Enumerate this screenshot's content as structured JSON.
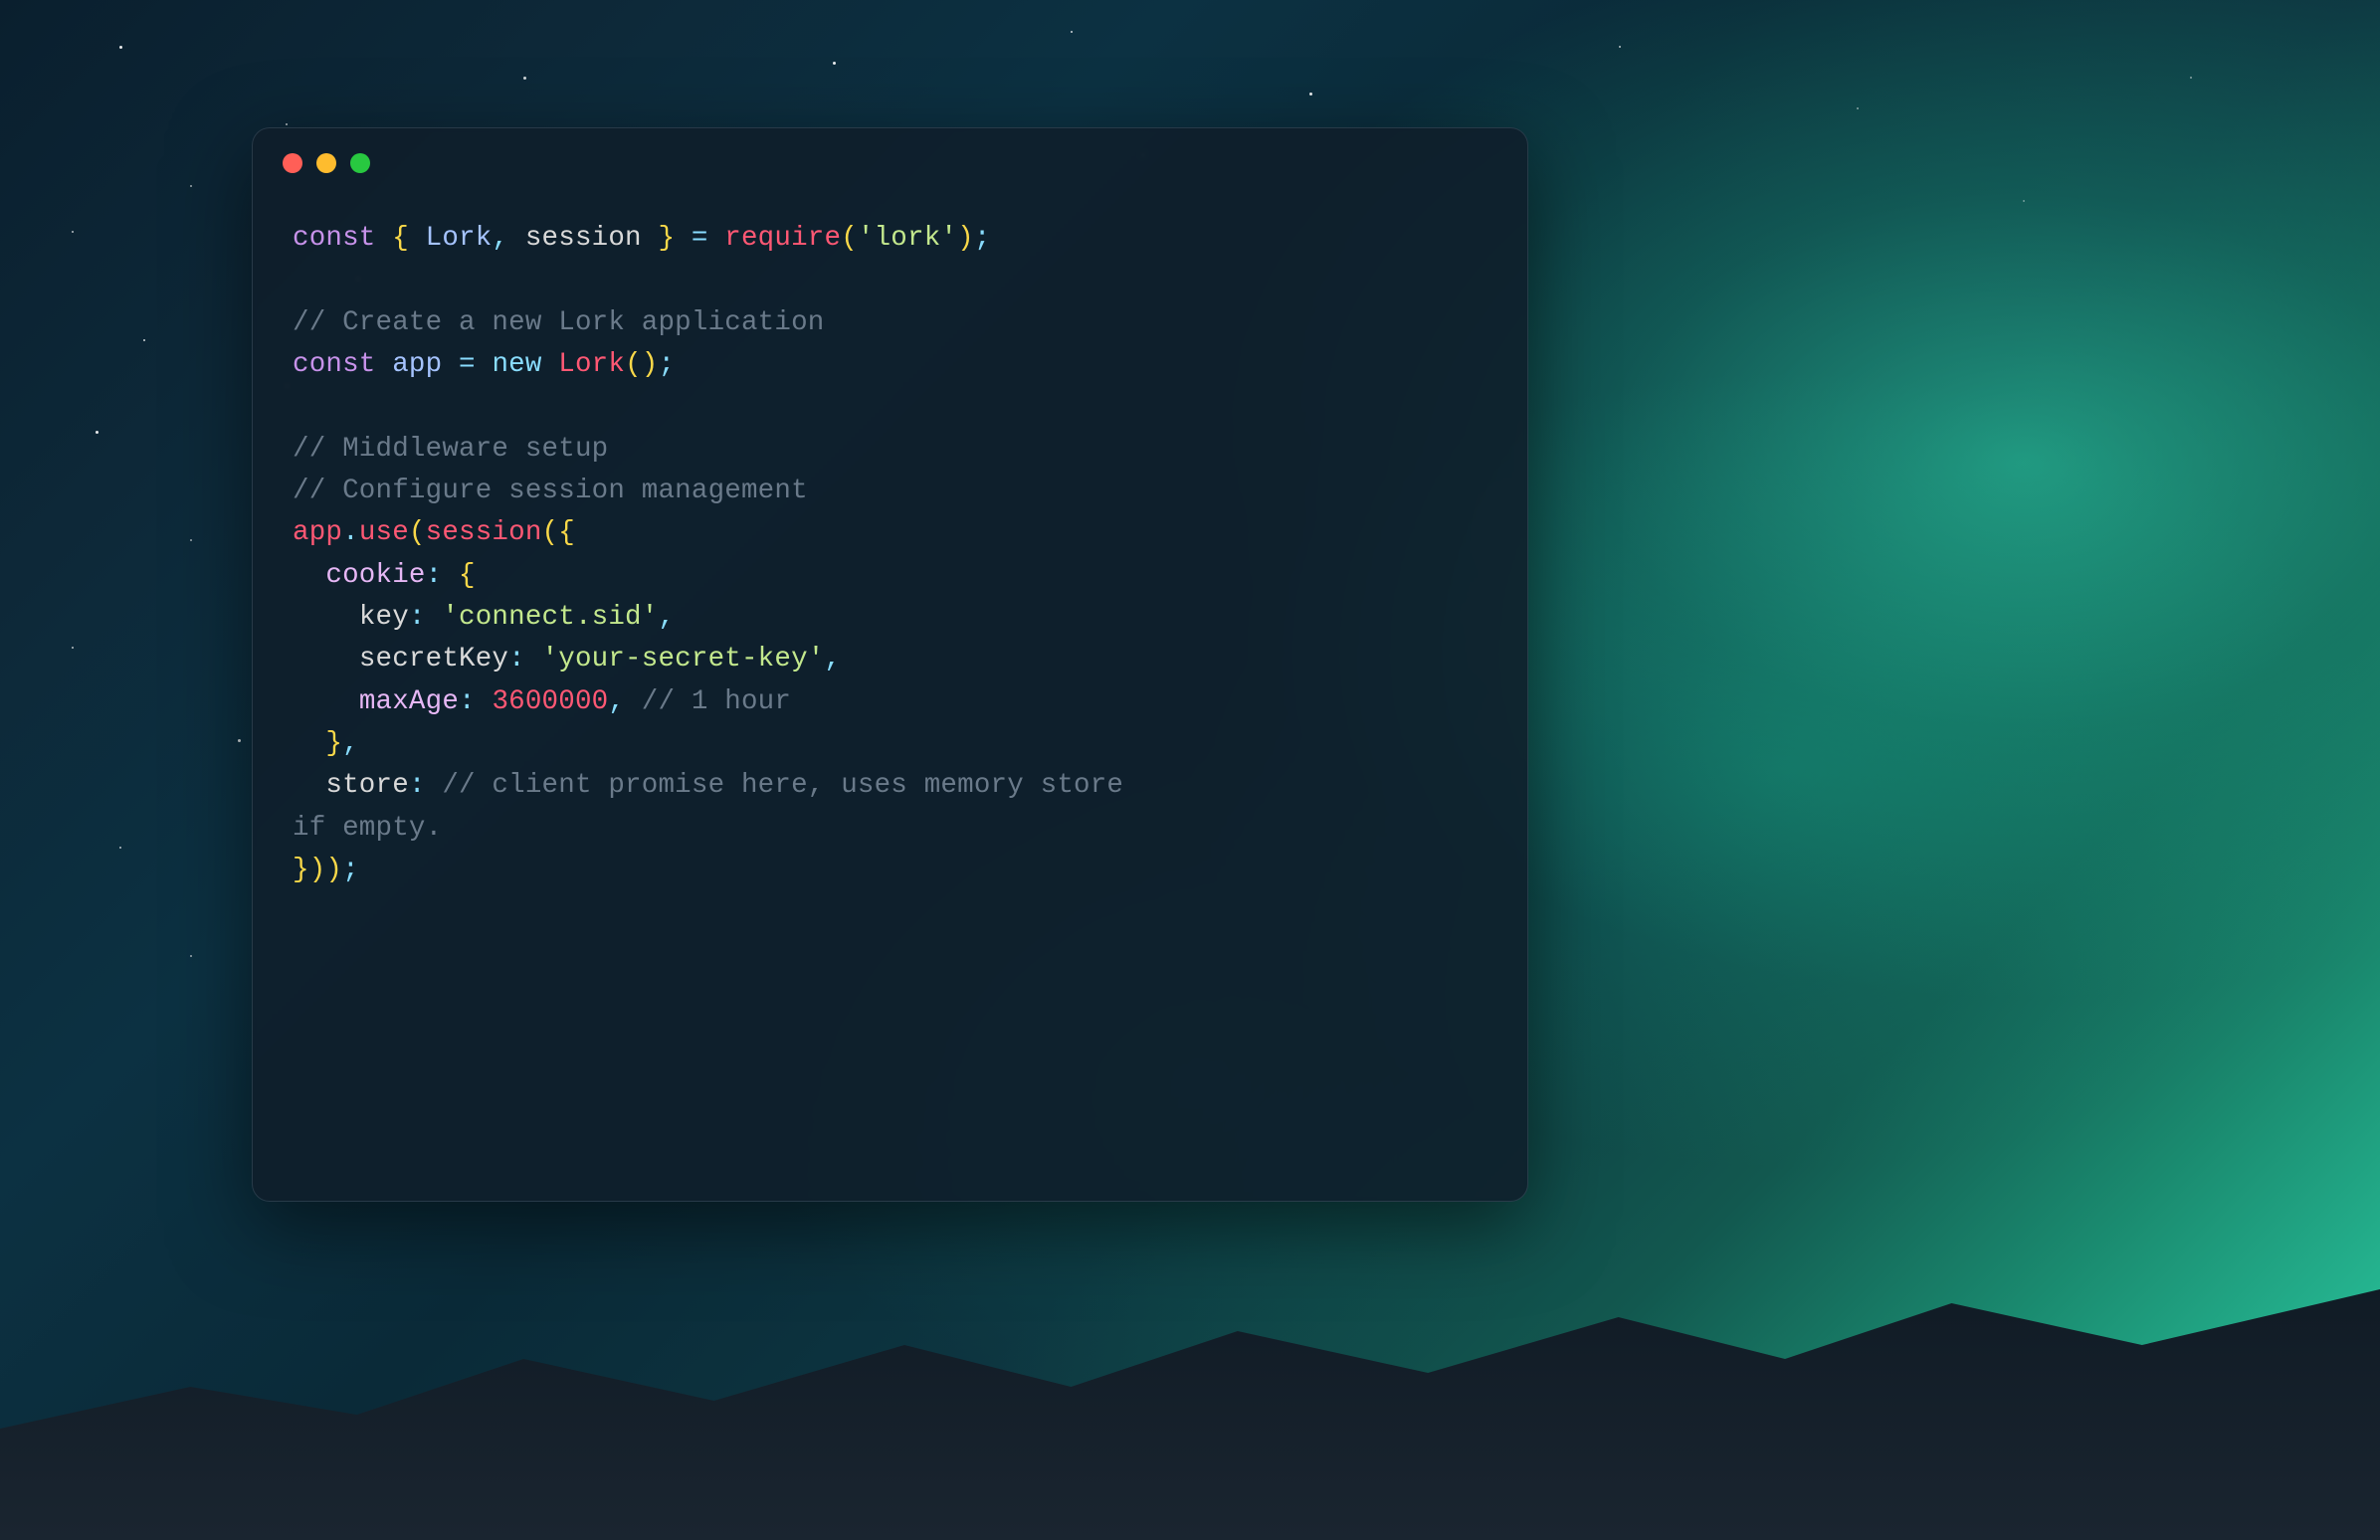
{
  "window": {
    "traffic_lights": {
      "close": "close",
      "minimize": "minimize",
      "zoom": "zoom"
    }
  },
  "code": {
    "line1": {
      "const": "const",
      "space1": " ",
      "lbrace": "{",
      "space2": " ",
      "lork": "Lork",
      "comma": ",",
      "space3": " ",
      "session": "session",
      "space4": " ",
      "rbrace": "}",
      "space5": " ",
      "eq": "=",
      "space6": " ",
      "require": "require",
      "lparen": "(",
      "str": "'lork'",
      "rparen": ")",
      "semi": ";"
    },
    "line3_comment": "// Create a new Lork application",
    "line4": {
      "const": "const",
      "space1": " ",
      "app": "app",
      "space2": " ",
      "eq": "=",
      "space3": " ",
      "new": "new",
      "space4": " ",
      "lork": "Lork",
      "lparen": "(",
      "rparen": ")",
      "semi": ";"
    },
    "line6_comment": "// Middleware setup",
    "line7_comment": "// Configure session management",
    "line8": {
      "app": "app",
      "dot": ".",
      "use": "use",
      "lparen": "(",
      "session": "session",
      "lparen2": "(",
      "lbrace": "{"
    },
    "line9": {
      "indent": "  ",
      "cookie": "cookie",
      "colon": ":",
      "space": " ",
      "lbrace": "{"
    },
    "line10": {
      "indent": "    ",
      "key": "key",
      "colon": ":",
      "space": " ",
      "str": "'connect.sid'",
      "comma": ","
    },
    "line11": {
      "indent": "    ",
      "secretKey": "secretKey",
      "colon": ":",
      "space": " ",
      "str": "'your-secret-key'",
      "comma": ","
    },
    "line12": {
      "indent": "    ",
      "maxAge": "maxAge",
      "colon": ":",
      "space": " ",
      "num": "3600000",
      "comma": ",",
      "space2": " ",
      "comment": "// 1 hour"
    },
    "line13": {
      "indent": "  ",
      "rbrace": "}",
      "comma": ","
    },
    "line14": {
      "indent": "  ",
      "store": "store",
      "colon": ":",
      "space": " ",
      "comment": "// client promise here, uses memory store"
    },
    "line15_comment": "if empty.",
    "line16": {
      "rbrace": "}",
      "rparen": ")",
      "rparen2": ")",
      "semi": ";"
    }
  }
}
